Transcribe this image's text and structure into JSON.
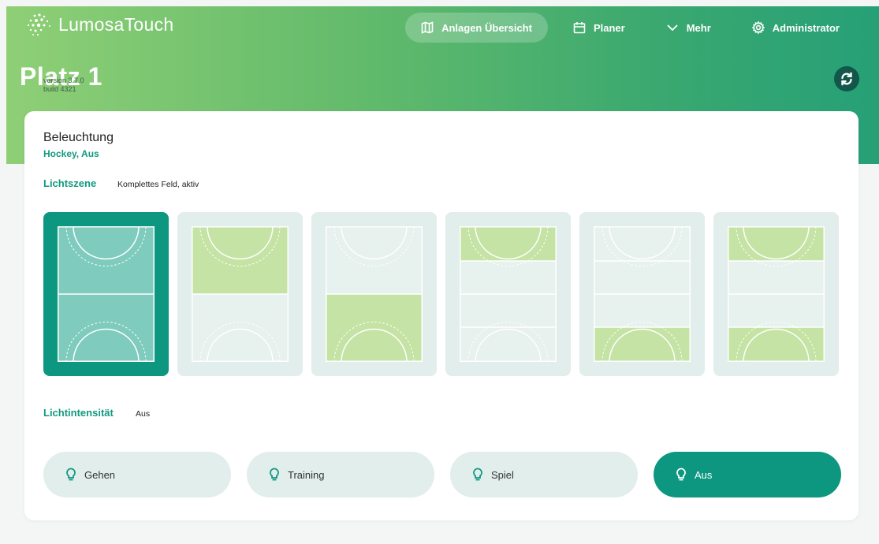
{
  "header": {
    "logo_text": "LumosaTouch",
    "nav": [
      {
        "label": "Anlagen Übersicht",
        "icon": "map-icon",
        "active": true
      },
      {
        "label": "Planer",
        "icon": "calendar-icon",
        "active": false
      },
      {
        "label": "Mehr",
        "icon": "chevron-down-icon",
        "active": false
      },
      {
        "label": "Administrator",
        "icon": "gear-icon",
        "active": false
      }
    ]
  },
  "page": {
    "title": "Platz 1",
    "version_line1": "version 3.7.0",
    "version_line2": "build 4321"
  },
  "lighting": {
    "title": "Beleuchtung",
    "subtitle": "Hockey, Aus",
    "scene_label": "Lichtszene",
    "scene_value": "Komplettes Feld, aktiv",
    "scenes": [
      {
        "name": "komplettes-feld",
        "active": true
      },
      {
        "name": "obere-haelfte",
        "active": false
      },
      {
        "name": "untere-haelfte",
        "active": false
      },
      {
        "name": "oberer-kreis",
        "active": false
      },
      {
        "name": "unterer-kreis",
        "active": false
      },
      {
        "name": "beide-kreise",
        "active": false
      }
    ],
    "intensity_label": "Lichtintensität",
    "intensity_value": "Aus",
    "intensity_buttons": [
      {
        "label": "Gehen",
        "active": false
      },
      {
        "label": "Training",
        "active": false
      },
      {
        "label": "Spiel",
        "active": false
      },
      {
        "label": "Aus",
        "active": true
      }
    ]
  },
  "colors": {
    "accent": "#0d9780",
    "scene_bg": "#e1eeeb",
    "field_lit": "#c5e3a4",
    "field_lit_active": "#7fcbbd"
  }
}
